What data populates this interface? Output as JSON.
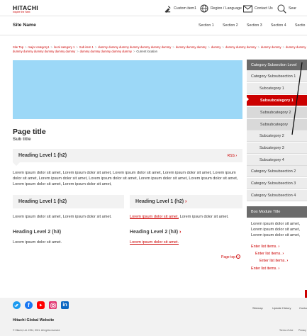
{
  "header": {
    "logo": "HITACHI",
    "tagline": "Inspire the Next",
    "custom_item": "Custom item1",
    "region": "Region / Language",
    "contact": "Contact Us",
    "search": "Sear"
  },
  "sitebar": {
    "site_name": "Site Name",
    "sections": [
      "Section 1",
      "Section 2",
      "Section 3",
      "Section 4",
      "Sectio"
    ]
  },
  "breadcrumb": {
    "items": [
      "Site Top",
      "major category1",
      "local category 1",
      "Sub item 1",
      "dummy dummy dummy dummy dummy dummy dummy",
      "dummy dummy dummy dummy dummy dummy dummy dummy",
      "dummy dummy dummy",
      "dummy",
      "dummy dummy dummy",
      "dummy dummy",
      "dummy dummy dummy dummy dummy"
    ],
    "current": "Current location"
  },
  "main": {
    "page_title": "Page title",
    "sub_title": "Sub title",
    "h2_rss": "Heading Level 1 (h2)",
    "rss": "RSS",
    "lorem_long": "Lorem ipsum dolor sit amet, Lorem ipsum dolor sit amet, Lorem ipsum dolor sit amet, Lorem ipsum dolor sit amet, Lorem ipsum dolor sit amet, Lorem ipsum dolor sit amet, Lorem ipsum dolor sit amet, Lorem ipsum dolor sit amet, Lorem ipsum dolor sit amet, Lorem ipsum dolor sit amet, Lorem ipsum dolor sit amet,",
    "col_left_h2": "Heading Level 1 (h2)",
    "col_right_h2": "Heading Level 1 (h2)",
    "lorem_left": "Lorem ipsum dolor sit amet, Lorem ipsum dolor sit amet.",
    "lorem_right_link": "Lorem ipsum dolor sit amet.",
    "lorem_right_rest": " Lorem ipsum dolor sit amet.",
    "h3_left": "Heading Level 2 (h3)",
    "h3_right": "Heading Level 2 (h3)",
    "lorem_short": "Lorem ipsum dolor sit amet.",
    "lorem_short_link": "Lorem ipsum dolor sit amet.",
    "page_top": "Page top"
  },
  "side": {
    "items": [
      {
        "label": "Category Subsection Level",
        "kind": "header"
      },
      {
        "label": "Category Subsubsection 1",
        "kind": "level1"
      },
      {
        "label": "Subcategory 1",
        "kind": "level2"
      },
      {
        "label": "Subsubcategory 1",
        "kind": "active"
      },
      {
        "label": "Subsubcategory 2",
        "kind": "level3"
      },
      {
        "label": "Subsubcategory",
        "kind": "level3"
      },
      {
        "label": "Subcategory 2",
        "kind": "level2"
      },
      {
        "label": "Subcategory 3",
        "kind": "level2"
      },
      {
        "label": "Subcategory 4",
        "kind": "level2"
      },
      {
        "label": "Category Subsubsection 2",
        "kind": "level1"
      },
      {
        "label": "Category Subsubsection 3",
        "kind": "level1"
      },
      {
        "label": "Category Subsubsection 4",
        "kind": "level1"
      }
    ],
    "box_title": "Box Module Title",
    "box_text": "Lorem ipsum dolor sit amet, Lorem ipsum dolor sit amet, Lorem ipsum dolor sit amet,",
    "list": [
      "Enter list items.",
      "Enter list items.",
      "Enter list items.",
      "Enter list items."
    ]
  },
  "footer": {
    "links": [
      "Sitemap",
      "Update History",
      "Conta"
    ],
    "global": "Hitachi Global Website",
    "copyright": "© Hitachi, Ltd. 1994, 2021. All rights reserved.",
    "small_links": [
      "Terms of Use",
      "Privacy"
    ]
  },
  "colors": {
    "accent": "#cc0000",
    "hero": "#9cd8f7",
    "box_title": "#6b6b6b"
  }
}
